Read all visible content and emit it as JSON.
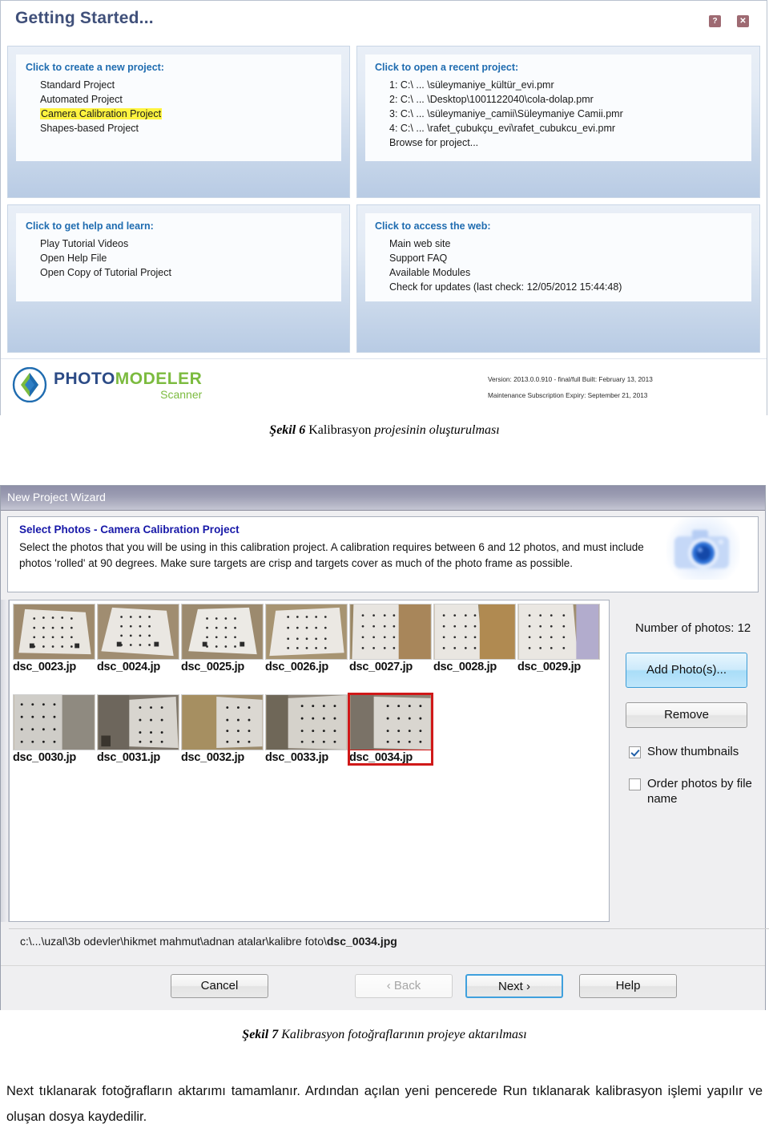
{
  "figure1": {
    "window_title": "Getting Started...",
    "window_buttons": [
      {
        "name": "help",
        "glyph": "?"
      },
      {
        "name": "close",
        "glyph": "✕"
      }
    ],
    "panels": [
      {
        "id": "new-project",
        "title": "Click to create a new project:",
        "items": [
          {
            "label": "Standard Project",
            "highlight": false
          },
          {
            "label": "Automated Project",
            "highlight": false
          },
          {
            "label": "Camera Calibration Project",
            "highlight": true
          },
          {
            "label": "Shapes-based Project",
            "highlight": false
          }
        ]
      },
      {
        "id": "recent-project",
        "title": "Click to open a recent project:",
        "items": [
          {
            "label": "1: C:\\ ... \\süleymaniye_kültür_evi.pmr",
            "highlight": false
          },
          {
            "label": "2: C:\\ ... \\Desktop\\1001122040\\cola-dolap.pmr",
            "highlight": false
          },
          {
            "label": "3: C:\\ ... \\süleymaniye_camii\\Süleymaniye Camii.pmr",
            "highlight": false
          },
          {
            "label": "4: C:\\ ... \\rafet_çubukçu_evi\\rafet_cubukcu_evi.pmr",
            "highlight": false
          },
          {
            "label": "Browse for project...",
            "highlight": false
          }
        ]
      },
      {
        "id": "help-learn",
        "title": "Click to get help and learn:",
        "items": [
          {
            "label": "Play Tutorial Videos",
            "highlight": false
          },
          {
            "label": "Open Help File",
            "highlight": false
          },
          {
            "label": "Open Copy of Tutorial Project",
            "highlight": false
          }
        ]
      },
      {
        "id": "access-web",
        "title": "Click to access the web:",
        "items": [
          {
            "label": "Main web site",
            "highlight": false
          },
          {
            "label": "Support FAQ",
            "highlight": false
          },
          {
            "label": "Available Modules",
            "highlight": false
          },
          {
            "label": "Check for updates (last check: 12/05/2012 15:44:48)",
            "highlight": false
          }
        ]
      }
    ],
    "logo": {
      "word_a": "PHOTO",
      "word_b": "MODELER",
      "sub": "Scanner"
    },
    "version_line1": "Version: 2013.0.0.910 - final/full Built: February 13, 2013",
    "version_line2": "Maintenance Subscription Expiry: September 21, 2013",
    "accent_blue": "#1f6cb0",
    "highlight_yellow": "#fff43f"
  },
  "caption6": {
    "bold": "Şekil 6",
    "rest_plain": " Kalibrasyon ",
    "rest_italic": "projesinin oluşturulması"
  },
  "figure2": {
    "window_title": "New Project Wizard",
    "header_title": "Select Photos - Camera Calibration Project",
    "header_text": "Select the photos that you will be using in this calibration project. A calibration requires between 6 and 12 photos, and must include photos 'rolled' at 90 degrees. Make sure targets are crisp and targets cover as much of the photo frame as possible.",
    "header_icon": "camera-icon",
    "photos_row1": [
      {
        "name": "dsc_0023.jp",
        "selected": false
      },
      {
        "name": "dsc_0024.jp",
        "selected": false
      },
      {
        "name": "dsc_0025.jp",
        "selected": false
      },
      {
        "name": "dsc_0026.jp",
        "selected": false
      },
      {
        "name": "dsc_0027.jp",
        "selected": false
      },
      {
        "name": "dsc_0028.jp",
        "selected": false
      },
      {
        "name": "dsc_0029.jp",
        "selected": false
      }
    ],
    "photos_row2": [
      {
        "name": "dsc_0030.jp",
        "selected": false
      },
      {
        "name": "dsc_0031.jp",
        "selected": false
      },
      {
        "name": "dsc_0032.jp",
        "selected": false
      },
      {
        "name": "dsc_0033.jp",
        "selected": false
      },
      {
        "name": "dsc_0034.jp",
        "selected": true
      }
    ],
    "side": {
      "count_label": "Number of photos: 12",
      "add_button": "Add Photo(s)...",
      "remove_button": "Remove",
      "show_thumbnails_label": "Show thumbnails",
      "show_thumbnails_checked": true,
      "order_by_name_label": "Order photos by file name",
      "order_by_name_checked": false
    },
    "path_prefix": "c:\\...\\uzal\\3b odevler\\hikmet mahmut\\adnan atalar\\kalibre foto\\",
    "path_file": "dsc_0034.jpg",
    "buttons": {
      "cancel": "Cancel",
      "back": "‹ Back",
      "next": "Next ›",
      "help": "Help"
    },
    "selection_red": "#d01919",
    "focus_blue": "#3fa0dd"
  },
  "caption7": {
    "bold": "Şekil 7",
    "rest_italic": " Kalibrasyon fotoğraflarının projeye aktarılması"
  },
  "body_text": "Next tıklanarak fotoğrafların aktarımı tamamlanır. Ardından açılan yeni pencerede Run tıklanarak kalibrasyon işlemi yapılır ve oluşan dosya kaydedilir."
}
